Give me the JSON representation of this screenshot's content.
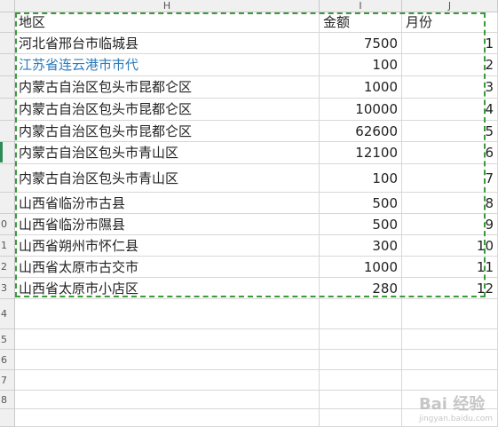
{
  "columns": [
    "H",
    "I",
    "J"
  ],
  "header": {
    "region": "地区",
    "amount": "金额",
    "month": "月份"
  },
  "rows": [
    {
      "region": "河北省邢台市临城县",
      "amount": "7500",
      "month": "1",
      "blue": false
    },
    {
      "region": "江苏省连云港市市代",
      "amount": "100",
      "month": "2",
      "blue": true
    },
    {
      "region": "内蒙古自治区包头市昆都仑区",
      "amount": "1000",
      "month": "3",
      "blue": false
    },
    {
      "region": "内蒙古自治区包头市昆都仑区",
      "amount": "10000",
      "month": "4",
      "blue": false
    },
    {
      "region": "内蒙古自治区包头市昆都仑区",
      "amount": "62600",
      "month": "5",
      "blue": false
    },
    {
      "region": "内蒙古自治区包头市青山区",
      "amount": "12100",
      "month": "6",
      "blue": false
    },
    {
      "region": "内蒙古自治区包头市青山区",
      "amount": "100",
      "month": "7",
      "blue": false
    },
    {
      "region": "山西省临汾市古县",
      "amount": "500",
      "month": "8",
      "blue": false
    },
    {
      "region": "山西省临汾市隰县",
      "amount": "500",
      "month": "9",
      "blue": false
    },
    {
      "region": "山西省朔州市怀仁县",
      "amount": "300",
      "month": "10",
      "blue": false
    },
    {
      "region": "山西省太原市古交市",
      "amount": "1000",
      "month": "11",
      "blue": false
    },
    {
      "region": "山西省太原市小店区",
      "amount": "280",
      "month": "12",
      "blue": false
    }
  ],
  "row_numbers": [
    "",
    "",
    "",
    "",
    "",
    "",
    "",
    "",
    "",
    "0",
    "1",
    "2",
    "3",
    "4",
    "5",
    "6",
    "7",
    "8"
  ],
  "watermark": {
    "main": "Bai 经验",
    "sub": "jingyan.baidu.com"
  },
  "colors": {
    "marquee": "#3a9a3a",
    "blue_text": "#2b7bbd"
  }
}
